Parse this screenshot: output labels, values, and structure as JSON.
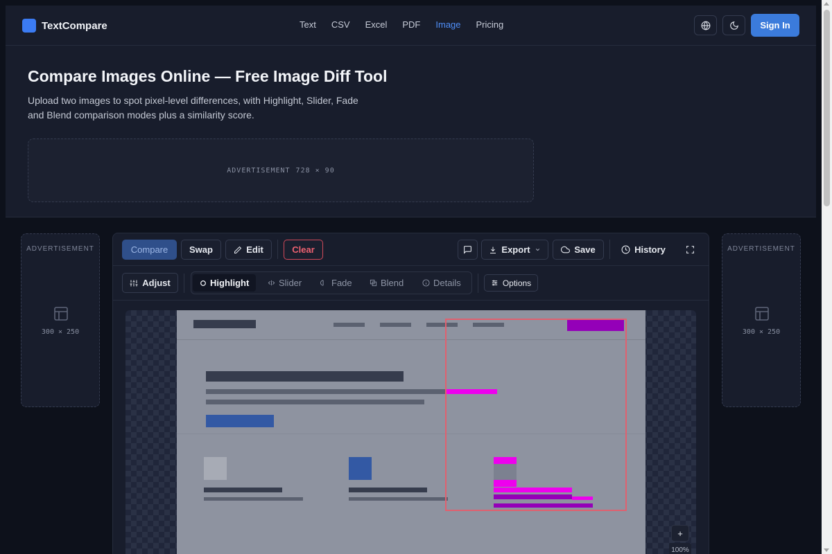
{
  "brand": {
    "name": "TextCompare"
  },
  "nav": {
    "links": [
      "Text",
      "CSV",
      "Excel",
      "PDF",
      "Image",
      "Pricing"
    ],
    "active": "Image",
    "sign_in": "Sign In"
  },
  "hero": {
    "title": "Compare Images Online — Free Image Diff Tool",
    "subtitle": "Upload two images to spot pixel-level differences, with Highlight, Slider, Fade and Blend comparison modes plus a similarity score."
  },
  "ads": {
    "banner_label": "ADVERTISEMENT",
    "banner_size": "728 × 90",
    "side_label": "ADVERTISEMENT",
    "side_size": "300 × 250"
  },
  "toolbar": {
    "compare": "Compare",
    "swap": "Swap",
    "edit": "Edit",
    "clear": "Clear",
    "export": "Export",
    "save": "Save",
    "history": "History"
  },
  "modes": {
    "adjust": "Adjust",
    "items": [
      "Highlight",
      "Slider",
      "Fade",
      "Blend",
      "Details"
    ],
    "active": "Highlight",
    "options": "Options"
  },
  "viewer": {
    "zoom_in": "+",
    "zoom_level": "100%"
  },
  "colors": {
    "accent": "#3b7bdb",
    "active_nav": "#4f8ef7",
    "danger": "#ef6271",
    "diff_magenta": "#ee00ee",
    "diff_purple": "#9400b8",
    "diff_box": "#e0606f"
  }
}
